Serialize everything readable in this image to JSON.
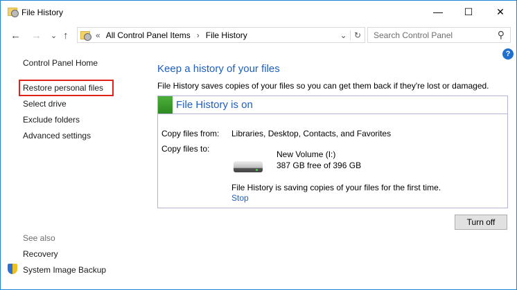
{
  "window": {
    "title": "File History",
    "minimize": "—",
    "maximize": "☐",
    "close": "✕"
  },
  "nav": {
    "back": "←",
    "forward": "→",
    "recent": "⌄",
    "up": "↑"
  },
  "address": {
    "overflow": "«",
    "crumbs": [
      "All Control Panel Items",
      "File History"
    ],
    "sep": "›",
    "dropdown": "⌄",
    "refresh": "↻"
  },
  "search": {
    "placeholder": "Search Control Panel",
    "icon": "⚲"
  },
  "help": "?",
  "sidebar": {
    "home": "Control Panel Home",
    "items": [
      "Restore personal files",
      "Select drive",
      "Exclude folders",
      "Advanced settings"
    ],
    "see_also": "See also",
    "see_also_items": [
      "Recovery",
      "System Image Backup"
    ]
  },
  "main": {
    "heading": "Keep a history of your files",
    "description": "File History saves copies of your files so you can get them back if they're lost or damaged.",
    "status_title": "File History is on",
    "copy_from_label": "Copy files from:",
    "copy_from_value": "Libraries, Desktop, Contacts, and Favorites",
    "copy_to_label": "Copy files to:",
    "drive_name": "New Volume (I:)",
    "drive_space": "387 GB free of 396 GB",
    "progress_text": "File History is saving copies of your files for the first time.",
    "stop": "Stop",
    "turn_off": "Turn off"
  },
  "colors": {
    "accent": "#1e5ebd",
    "status_green": "#3a9a2d",
    "highlight": "#e0201b"
  }
}
